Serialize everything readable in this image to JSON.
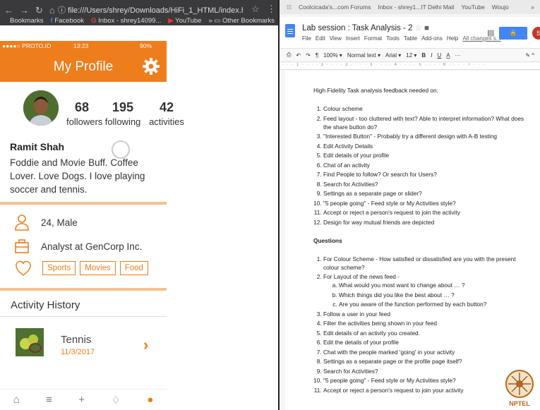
{
  "browser": {
    "url": "file:///Users/shrey/Downloads/HiFi_1_HTML/index.html#10",
    "bookmarks": [
      {
        "label": "Bookmarks",
        "cls": ""
      },
      {
        "label": "Facebook",
        "cls": "fb"
      },
      {
        "label": "Inbox - shrey14099...",
        "cls": "g"
      },
      {
        "label": "YouTube",
        "cls": "yt"
      }
    ],
    "other_bookmarks": "Other Bookmarks"
  },
  "phone": {
    "carrier": "●●●●○ PROTO.IO",
    "time": "13:23",
    "battery": "90%",
    "title": "My Profile",
    "stats": [
      {
        "number": "68",
        "label": "followers"
      },
      {
        "number": "195",
        "label": "following"
      },
      {
        "number": "42",
        "label": "activities"
      }
    ],
    "name": "Ramit Shah",
    "bio": "Foddie and Movie Buff. Coffee Lover. Love Dogs. I love playing soccer and tennis.",
    "age_gender": "24, Male",
    "job": "Analyst at GenCorp Inc.",
    "interests": [
      "Sports",
      "Movies",
      "Food"
    ],
    "activity_history_title": "Activity History",
    "activity": {
      "title": "Tennis",
      "date": "11/3/2017"
    },
    "accent": "#ee7d1c"
  },
  "docs": {
    "browser_tabs": [
      "Coolcicada's...com Forums",
      "Inbox - shrey1...IT Delhi Mail",
      "YouTube",
      "Woujo"
    ],
    "doc_title": "Lab session : Task Analysis - 2",
    "menu": [
      "File",
      "Edit",
      "View",
      "Insert",
      "Format",
      "Tools",
      "Table",
      "Add-ons",
      "Help"
    ],
    "changes": "All changes s...",
    "share": "SHARE",
    "account_initial": "S",
    "toolbar": {
      "zoom": "100%",
      "style": "Normal text",
      "font": "Arial",
      "size": "12"
    },
    "heading": "High Fidelity Task analysis feedback needed on:",
    "feedback": [
      "Colour scheme",
      "Feed layout - too cluttered with text? Able to interpret information? What does the share button do?",
      "\"Interested Button\" - Probably try a different design with A-B testing",
      "Edit Activity Details",
      "Edit details of your profile",
      "Chat of an activity",
      "Find People to follow? Or search for Users?",
      "Search for Activities?",
      "Settings as a separate page or slider?",
      "\"5 people going\" - Feed style or My Activities style?",
      "Accept or reject a person's request to join the activity",
      "Design for way mutual friends are depicted"
    ],
    "questions_title": "Questions",
    "questions_before": [
      "For Colour Scheme - How satisfied or dissatisfied are you with the present colour scheme?",
      "For Layout of the news feed -"
    ],
    "sub_questions": [
      "What would you most want to change about … ?",
      "Which things did you like the best about … ?",
      "Are you aware of the function performed by each button?"
    ],
    "questions_after": [
      "Follow a user in your feed",
      "Filter the activities being shown in your feed",
      "Edit details of an activity you created.",
      "Edit the details of your profile",
      "Chat with the people marked 'going' in your activity",
      "Settings as a separate page or the profile page itself?",
      "Search for Activities?",
      "\"5 people going\" - Feed style or My Activities style?",
      "Accept or reject a person's request to join your activity"
    ],
    "watermark": "NPTEL"
  }
}
